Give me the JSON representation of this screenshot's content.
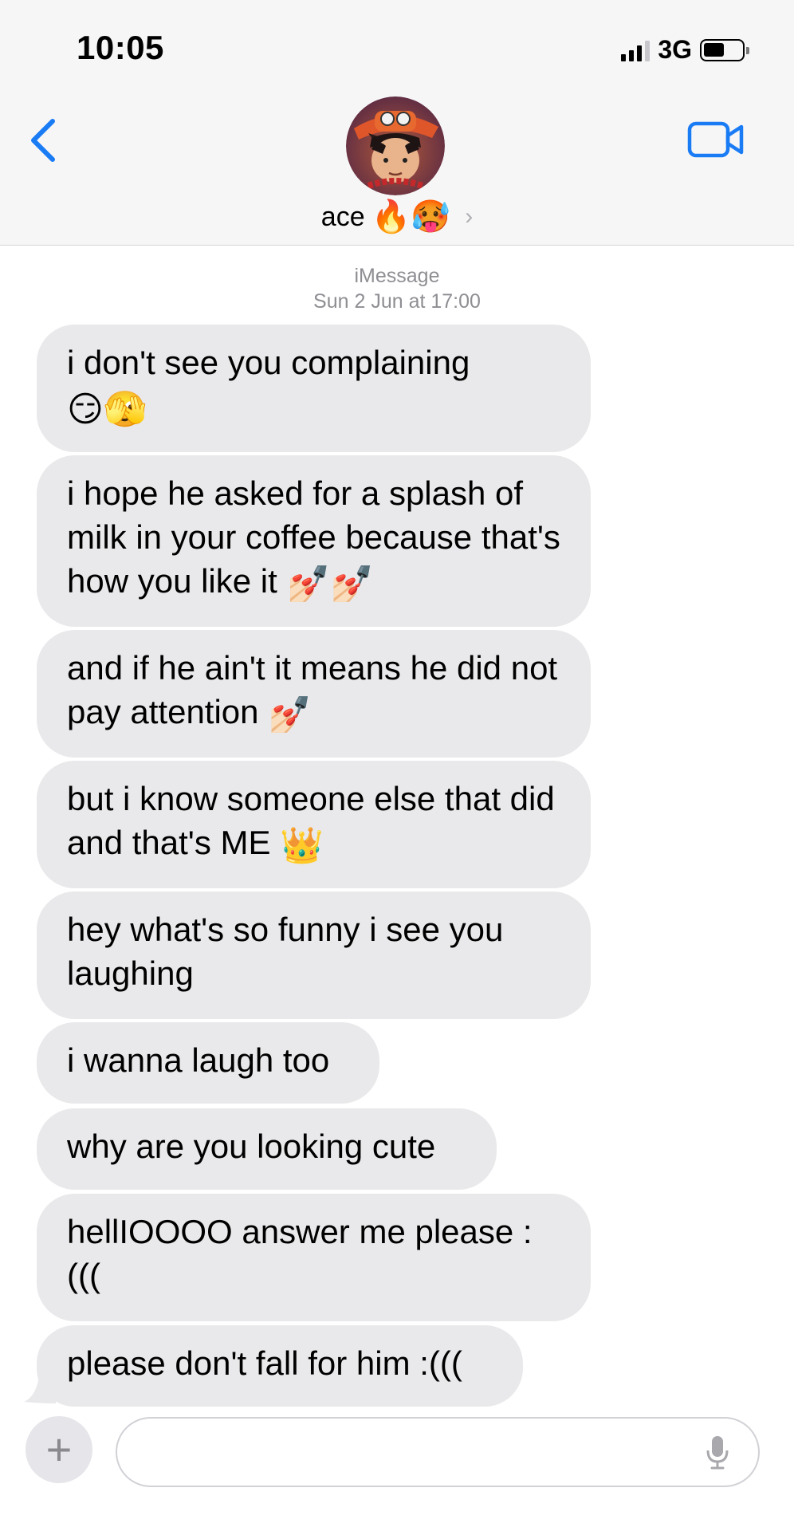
{
  "status_bar": {
    "time": "10:05",
    "network": "3G"
  },
  "header": {
    "contact_name": "ace",
    "name_emojis": "🔥🥵",
    "chevron": "›"
  },
  "thread": {
    "service": "iMessage",
    "timestamp": "Sun 2 Jun at 17:00"
  },
  "messages": [
    {
      "text": "i don't see you complaining",
      "emoji": "😏🫣"
    },
    {
      "text": "i hope he asked for a splash of milk in your coffee because that's how you like it",
      "emoji": "💅🏻💅🏻"
    },
    {
      "text": "and if he ain't it means he did not pay attention",
      "emoji": "💅🏻"
    },
    {
      "text": "but i know someone else that did and that's ME",
      "emoji": "👑"
    },
    {
      "text": "hey what's so funny i see you laughing",
      "emoji": ""
    },
    {
      "text": "i wanna laugh too",
      "emoji": ""
    },
    {
      "text": "why are you looking cute",
      "emoji": ""
    },
    {
      "text": "hellIOOOO answer me please :(((",
      "emoji": ""
    },
    {
      "text": "please don't fall for him :(((",
      "emoji": ""
    }
  ],
  "composer": {
    "plus_label": "+"
  },
  "icons": {
    "back": "chevron-left-icon",
    "video": "video-camera-icon",
    "mic": "microphone-icon",
    "accent": "#1a7cf5"
  }
}
